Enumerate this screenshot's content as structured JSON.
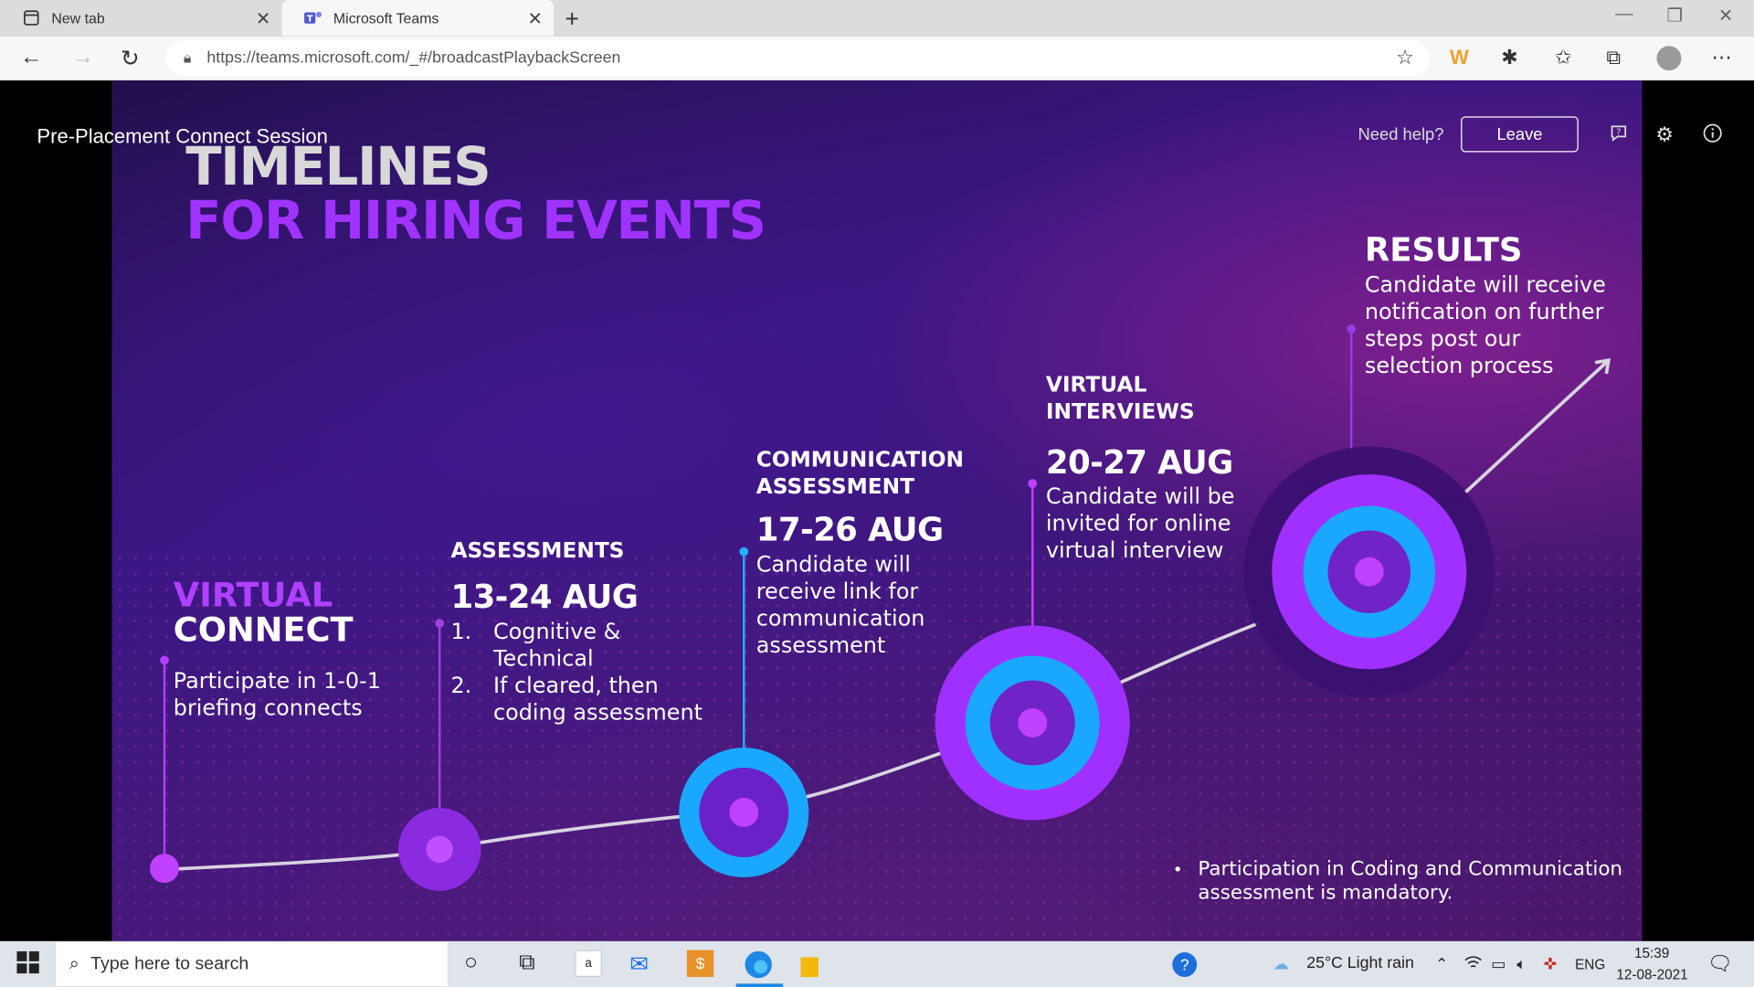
{
  "browser": {
    "tabs": [
      {
        "label": "New tab"
      },
      {
        "label": "Microsoft Teams"
      }
    ],
    "url": "https://teams.microsoft.com/_#/broadcastPlaybackScreen"
  },
  "teams": {
    "session_title": "Pre-Placement Connect Session",
    "help_label": "Need help?",
    "leave_label": "Leave"
  },
  "slide": {
    "title_line1": "TIMELINES",
    "title_line2": "FOR HIRING EVENTS",
    "stages": [
      {
        "heading_a": "VIRTUAL",
        "heading_b": "CONNECT",
        "text_1": "Participate in 1-0-1",
        "text_2": "briefing connects"
      },
      {
        "heading": "ASSESSMENTS",
        "date": "13-24 AUG",
        "item1_num": "1.",
        "item1_l1": "Cognitive &",
        "item1_l2": "Technical",
        "item2_num": "2.",
        "item2_l1": "If cleared, then",
        "item2_l2": "coding assessment"
      },
      {
        "heading_l1": "COMMUNICATION",
        "heading_l2": "ASSESSMENT",
        "date": "17-26 AUG",
        "text_1": "Candidate will",
        "text_2": "receive link for",
        "text_3": "communication",
        "text_4": "assessment"
      },
      {
        "heading_l1": "VIRTUAL",
        "heading_l2": "INTERVIEWS",
        "date": "20-27 AUG",
        "text_1": "Candidate will be",
        "text_2": "invited for online",
        "text_3": "virtual interview"
      },
      {
        "heading": "RESULTS",
        "text_1": "Candidate will receive",
        "text_2": "notification on further",
        "text_3": "steps post our",
        "text_4": "selection process"
      }
    ],
    "note_l1": "Participation in Coding and Communication",
    "note_l2": "assessment is mandatory."
  },
  "taskbar": {
    "search_placeholder": "Type here to search",
    "weather": "25°C  Light rain",
    "lang": "ENG",
    "time": "15:39",
    "date": "12-08-2021"
  },
  "colors": {
    "accent_purple": "#a033ff",
    "accent_cyan": "#00aaff",
    "title_gray": "#d8d8d8"
  }
}
